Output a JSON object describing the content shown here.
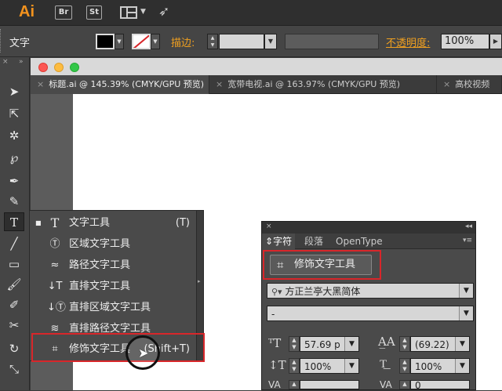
{
  "app": {
    "logo": "Ai",
    "buttons": [
      "Br",
      "St"
    ],
    "layout_icon": "layout-grid-icon",
    "rocket_icon": "rocket-icon"
  },
  "control_bar": {
    "tool_name": "文字",
    "stroke_label": "描边:",
    "opacity_label": "不透明度:",
    "opacity_value": "100%"
  },
  "tabs": [
    {
      "label": "标题.ai @ 145.39% (CMYK/GPU 预览)"
    },
    {
      "label": "宽带电视.ai @ 163.97% (CMYK/GPU 预览)"
    },
    {
      "label": "高校视频"
    }
  ],
  "flyout": {
    "items": [
      {
        "label": "文字工具",
        "shortcut": "(T)",
        "icon": "T",
        "active": true
      },
      {
        "label": "区域文字工具",
        "shortcut": "",
        "icon": "Ⓣ"
      },
      {
        "label": "路径文字工具",
        "shortcut": "",
        "icon": "≈"
      },
      {
        "label": "直排文字工具",
        "shortcut": "",
        "icon": "↓T"
      },
      {
        "label": "直排区域文字工具",
        "shortcut": "",
        "icon": "↓Ⓣ"
      },
      {
        "label": "直排路径文字工具",
        "shortcut": "",
        "icon": "≋"
      },
      {
        "label": "修饰文字工具",
        "shortcut": "(Shift+T)",
        "icon": "⌗"
      }
    ]
  },
  "panel": {
    "tabs": [
      "字符",
      "段落",
      "OpenType"
    ],
    "touch_button": "修饰文字工具",
    "font_family": "方正兰亭大黑简体",
    "font_style": "-",
    "font_size": "57.69 p",
    "leading": "(69.22)",
    "vertical_scale": "100%",
    "horizontal_scale": "100%",
    "kerning_value": "0"
  },
  "colors": {
    "accent": "#f4931e",
    "highlight": "#d8262a",
    "stroke_label_color": "#f0a020"
  }
}
